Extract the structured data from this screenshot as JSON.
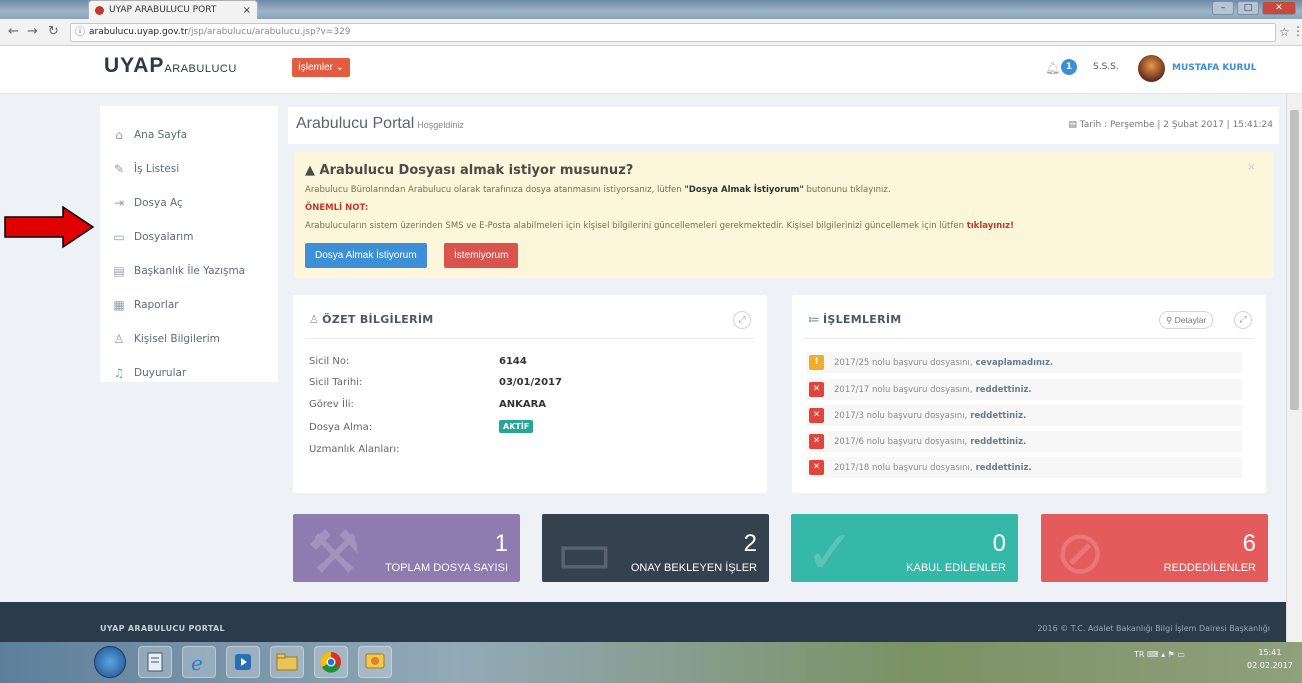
{
  "browser": {
    "tab_title": "UYAP ARABULUCU PORT",
    "tab_close": "×",
    "url_host": "arabulucu.uyap.gov.tr",
    "url_path": "/jsp/arabulucu/arabulucu.jsp?v=329"
  },
  "header": {
    "logo_main": "UYAP",
    "logo_sub": "ARABULUCU",
    "menu_label": "İşlemler",
    "notification_count": "1",
    "sss_label": "S.S.S.",
    "user_name": "MUSTAFA KURUL"
  },
  "sidebar": {
    "items": [
      {
        "label": "Ana Sayfa",
        "icon": "home-icon"
      },
      {
        "label": "İş Listesi",
        "icon": "edit-icon"
      },
      {
        "label": "Dosya Aç",
        "icon": "login-icon"
      },
      {
        "label": "Dosyalarım",
        "icon": "folder-icon"
      },
      {
        "label": "Başkanlık İle Yazışma",
        "icon": "document-icon"
      },
      {
        "label": "Raporlar",
        "icon": "grid-icon"
      },
      {
        "label": "Kişisel Bilgilerim",
        "icon": "users-icon"
      },
      {
        "label": "Duyurular",
        "icon": "bell-icon"
      }
    ]
  },
  "portal": {
    "title": "Arabulucu Portal",
    "welcome": "Hoşgeldiniz",
    "date": "Tarih : Perşembe | 2 Şubat 2017 | 15:41:24"
  },
  "alert": {
    "title": "Arabulucu Dosyası almak istiyor musunuz?",
    "line1_pre": "Arabulucu Bürolarından Arabulucu olarak tarafınıza dosya atanmasını istiyorsanız, lütfen ",
    "line1_bold": "\"Dosya Almak İstiyorum\"",
    "line1_post": " butonunu tıklayınız.",
    "onemli": "ÖNEMLİ NOT:",
    "line2_pre": "Arabulucuların sistem üzerinden SMS ve E-Posta alabilmeleri için kişisel bilgilerini güncellemeleri gerekmektedir. Kişisel bilgilerinizi güncellemek için lütfen ",
    "line2_link": "tıklayınız!",
    "btn_yes": "Dosya Almak İstiyorum",
    "btn_no": "İstemiyorum",
    "close": "×"
  },
  "ozet": {
    "title": "ÖZET BİLGİLERİM",
    "rows": [
      {
        "label": "Sicil No:",
        "value": "6144"
      },
      {
        "label": "Sicil Tarihi:",
        "value": "03/01/2017"
      },
      {
        "label": "Görev İli:",
        "value": "ANKARA"
      },
      {
        "label": "Dosya Alma:",
        "value": "AKTİF"
      },
      {
        "label": "Uzmanlık Alanları:",
        "value": ""
      }
    ]
  },
  "islemler": {
    "title": "İŞLEMLERİM",
    "detail_btn": "Detaylar",
    "items": [
      {
        "text": "2017/25 nolu başvuru dosyasını,",
        "status": "cevaplamadınız.",
        "type": "warn"
      },
      {
        "text": "2017/17 nolu başvuru dosyasını,",
        "status": "reddettiniz.",
        "type": "err"
      },
      {
        "text": "2017/3 nolu başvuru dosyasını,",
        "status": "reddettiniz.",
        "type": "err"
      },
      {
        "text": "2017/6 nolu başvuru dosyasını,",
        "status": "reddettiniz.",
        "type": "err"
      },
      {
        "text": "2017/18 nolu başvuru dosyasını,",
        "status": "reddettiniz.",
        "type": "err"
      }
    ]
  },
  "tiles": [
    {
      "value": "1",
      "label": "TOPLAM DOSYA SAYISI",
      "color": "#8e7bb0"
    },
    {
      "value": "2",
      "label": "ONAY BEKLEYEN İŞLER",
      "color": "#364150"
    },
    {
      "value": "0",
      "label": "KABUL EDİLENLER",
      "color": "#36b8a9"
    },
    {
      "value": "6",
      "label": "REDDEDİLENLER",
      "color": "#e35b5a"
    }
  ],
  "footer": {
    "left": "UYAP ARABULUCU PORTAL",
    "right": "2016 © T.C. Adalet Bakanlığı Bilgi İşlem Dairesi Başkanlığı"
  },
  "taskbar": {
    "lang": "TR",
    "time": "15:41",
    "date": "02.02.2017"
  },
  "colors": {
    "accent": "#3d8fd8",
    "danger": "#d9534f",
    "menu": "#e35b40",
    "sidebar_bg": "#ffffff",
    "alert_bg": "#fcf6db"
  }
}
